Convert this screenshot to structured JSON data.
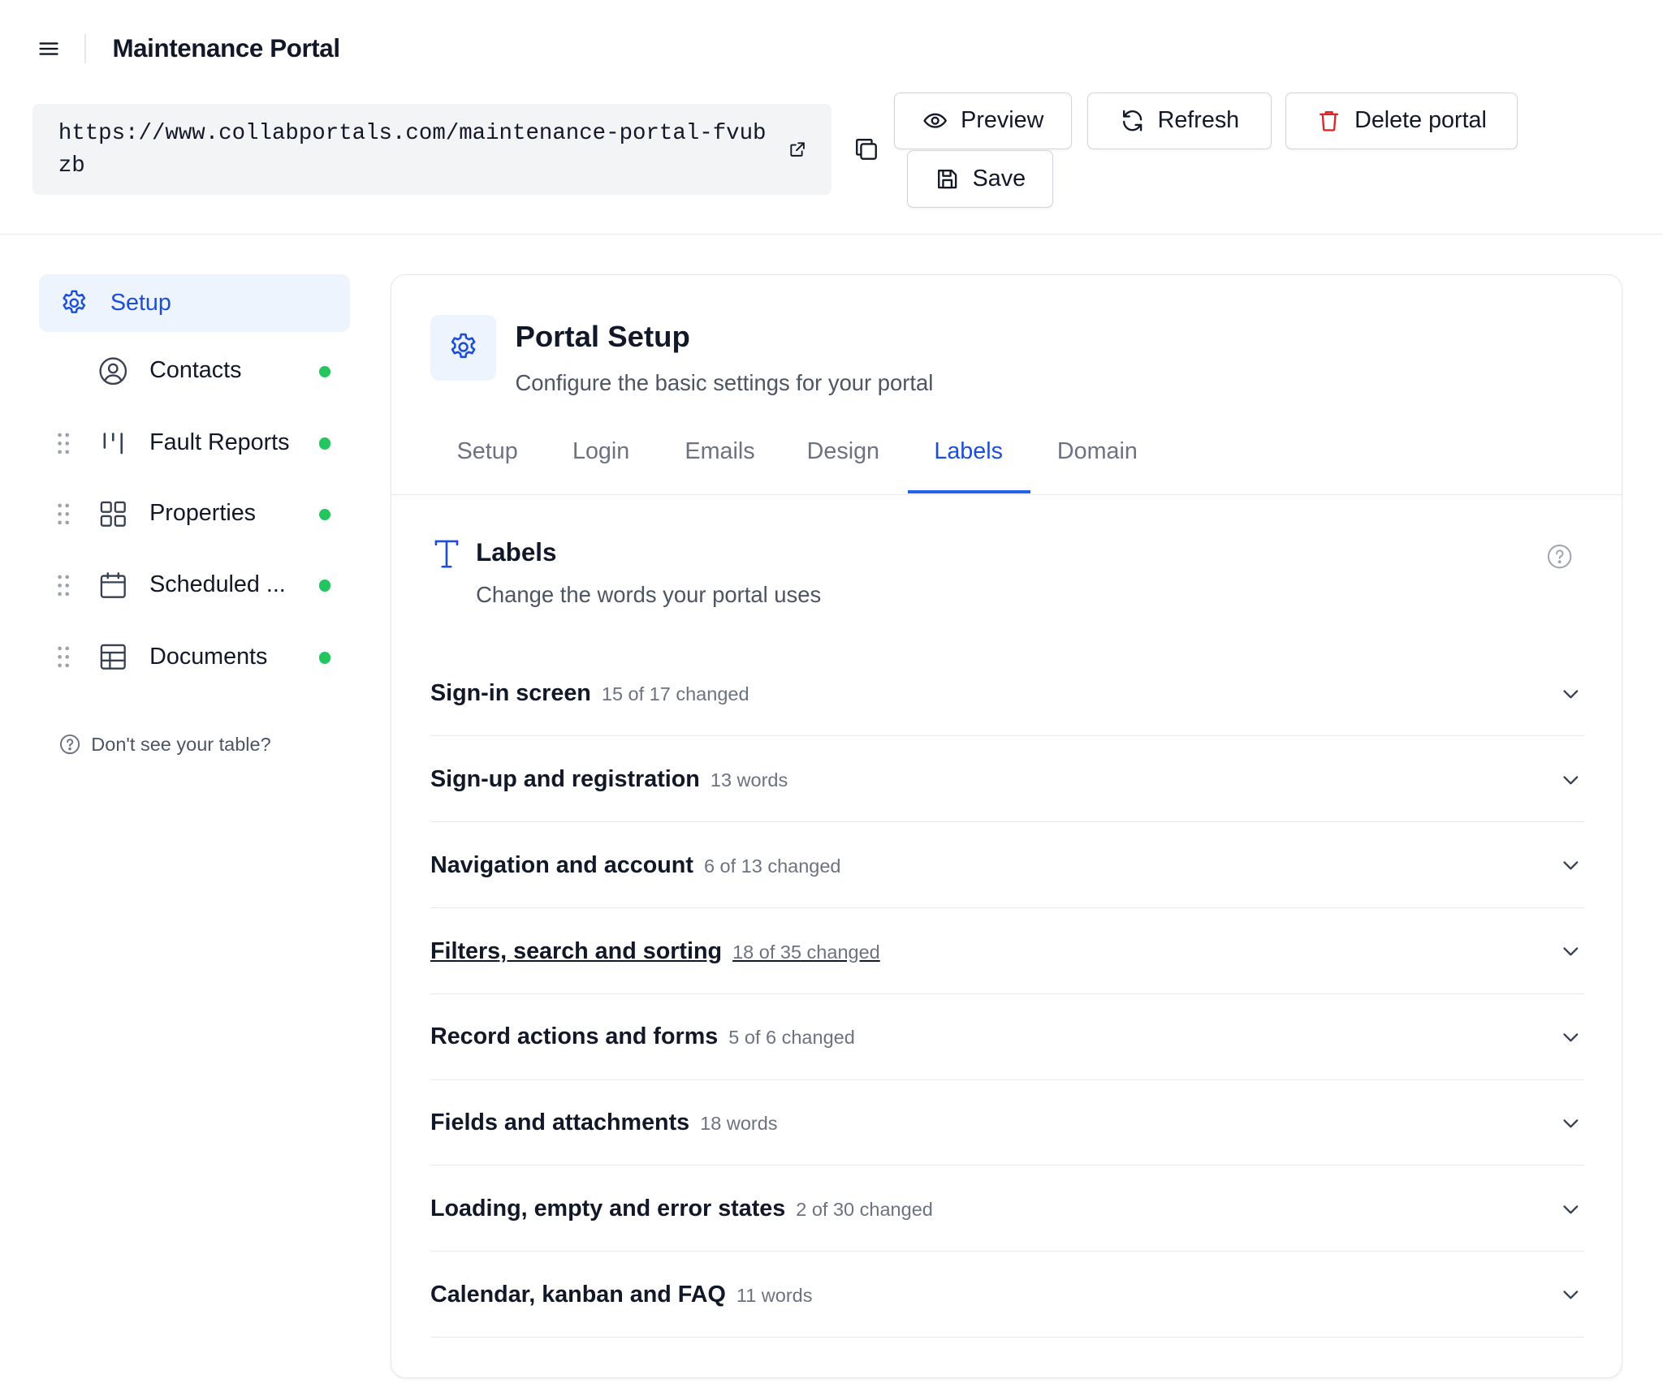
{
  "app": {
    "title": "Maintenance Portal"
  },
  "toolbar": {
    "url": "https://www.collabportals.com/maintenance-portal-fvubzb",
    "preview_label": "Preview",
    "refresh_label": "Refresh",
    "delete_label": "Delete portal",
    "save_label": "Save",
    "delete_color": "#dc2626"
  },
  "sidebar": {
    "active": {
      "label": "Setup",
      "icon": "gear-icon"
    },
    "items": [
      {
        "label": "Contacts",
        "icon": "user-circle-icon",
        "status": "active"
      },
      {
        "label": "Fault Reports",
        "icon": "kanban-columns-icon",
        "status": "active"
      },
      {
        "label": "Properties",
        "icon": "grid-icon",
        "status": "active"
      },
      {
        "label": "Scheduled ...",
        "icon": "calendar-icon",
        "status": "active"
      },
      {
        "label": "Documents",
        "icon": "table-icon",
        "status": "active"
      }
    ],
    "help_text": "Don't see your table?",
    "status_color": "#22c55e",
    "accent_color": "#1d4ed8"
  },
  "main": {
    "title": "Portal Setup",
    "subtitle": "Configure the basic settings for your portal",
    "tabs": [
      "Setup",
      "Login",
      "Emails",
      "Design",
      "Labels",
      "Domain"
    ],
    "active_tab": "Labels",
    "section": {
      "title": "Labels",
      "subtitle": "Change the words your portal uses"
    },
    "accordion": [
      {
        "title": "Sign-in screen",
        "meta": "15 of 17 changed"
      },
      {
        "title": "Sign-up and registration",
        "meta": "13 words"
      },
      {
        "title": "Navigation and account",
        "meta": "6 of 13 changed"
      },
      {
        "title": "Filters, search and sorting",
        "meta": "18 of 35 changed"
      },
      {
        "title": "Record actions and forms",
        "meta": "5 of 6 changed"
      },
      {
        "title": "Fields and attachments",
        "meta": "18 words"
      },
      {
        "title": "Loading, empty and error states",
        "meta": "2 of 30 changed"
      },
      {
        "title": "Calendar, kanban and FAQ",
        "meta": "11 words"
      }
    ]
  }
}
